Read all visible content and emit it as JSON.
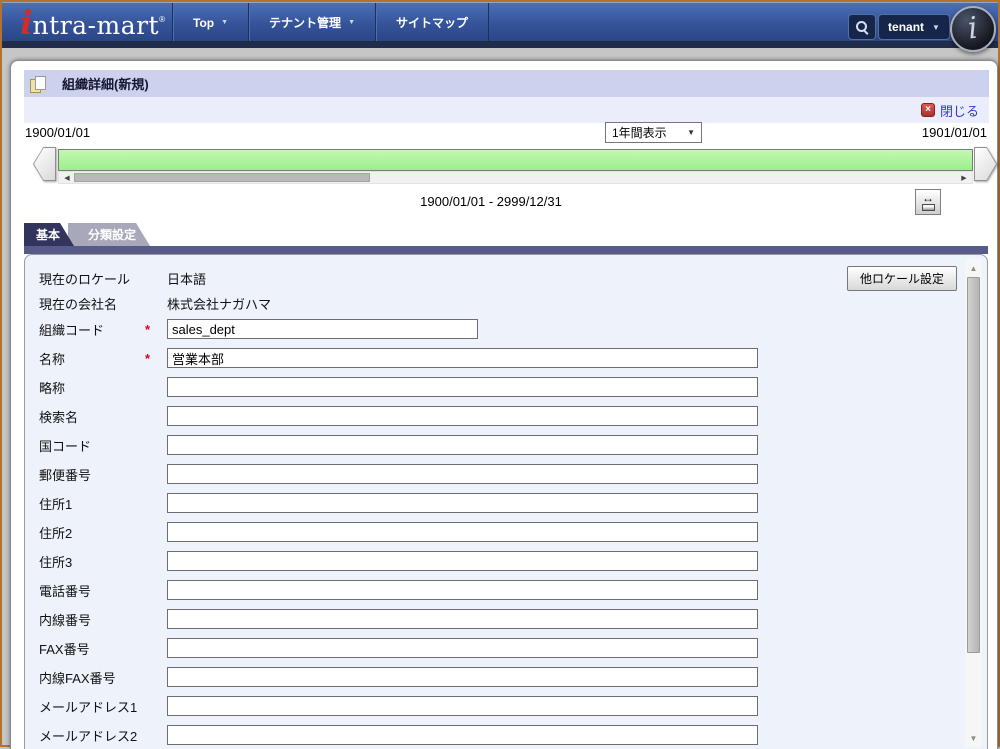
{
  "nav": {
    "logo": {
      "initial": "i",
      "rest": "ntra-mart",
      "registered": "®"
    },
    "menus": [
      {
        "label": "Top",
        "has_arrow": true
      },
      {
        "label": "テナント管理",
        "has_arrow": true
      },
      {
        "label": "サイトマップ",
        "has_arrow": false
      }
    ],
    "tenant_dropdown": "tenant",
    "corner_logo_glyph": "i"
  },
  "titlebar": {
    "title": "組織詳細(新規)",
    "close_label": "閉じる",
    "close_glyph": "×"
  },
  "timeline": {
    "start_date": "1900/01/01",
    "end_date": "1901/01/01",
    "range_select_value": "1年間表示",
    "range_text": "1900/01/01 - 2999/12/31",
    "fit_icon_glyph": "↔"
  },
  "tabs": [
    {
      "label": "基本",
      "active": true
    },
    {
      "label": "分類設定",
      "active": false
    }
  ],
  "form": {
    "other_locale_button": "他ロケール設定",
    "required_mark": "*",
    "rows": [
      {
        "key": "current-locale",
        "label": "現在のロケール",
        "type": "text",
        "value": "日本語",
        "required": false
      },
      {
        "key": "current-company",
        "label": "現在の会社名",
        "type": "text",
        "value": "株式会社ナガハマ",
        "required": false
      },
      {
        "key": "org-code",
        "label": "組織コード",
        "type": "input",
        "value": "sales_dept",
        "required": true,
        "width": "short"
      },
      {
        "key": "name",
        "label": "名称",
        "type": "input",
        "value": "営業本部",
        "required": true,
        "width": "long"
      },
      {
        "key": "short-name",
        "label": "略称",
        "type": "input",
        "value": "",
        "required": false,
        "width": "long"
      },
      {
        "key": "search-name",
        "label": "検索名",
        "type": "input",
        "value": "",
        "required": false,
        "width": "long"
      },
      {
        "key": "country-code",
        "label": "国コード",
        "type": "input",
        "value": "",
        "required": false,
        "width": "long"
      },
      {
        "key": "postal-code",
        "label": "郵便番号",
        "type": "input",
        "value": "",
        "required": false,
        "width": "long"
      },
      {
        "key": "address1",
        "label": "住所1",
        "type": "input",
        "value": "",
        "required": false,
        "width": "long"
      },
      {
        "key": "address2",
        "label": "住所2",
        "type": "input",
        "value": "",
        "required": false,
        "width": "long"
      },
      {
        "key": "address3",
        "label": "住所3",
        "type": "input",
        "value": "",
        "required": false,
        "width": "long"
      },
      {
        "key": "phone",
        "label": "電話番号",
        "type": "input",
        "value": "",
        "required": false,
        "width": "long"
      },
      {
        "key": "extension",
        "label": "内線番号",
        "type": "input",
        "value": "",
        "required": false,
        "width": "long"
      },
      {
        "key": "fax",
        "label": "FAX番号",
        "type": "input",
        "value": "",
        "required": false,
        "width": "long"
      },
      {
        "key": "extension-fax",
        "label": "内線FAX番号",
        "type": "input",
        "value": "",
        "required": false,
        "width": "long"
      },
      {
        "key": "email1",
        "label": "メールアドレス1",
        "type": "input",
        "value": "",
        "required": false,
        "width": "long"
      },
      {
        "key": "email2",
        "label": "メールアドレス2",
        "type": "input",
        "value": "",
        "required": false,
        "width": "long"
      }
    ]
  },
  "colors": {
    "frame_border": "#b5722f",
    "nav_blue_top": "#4a71b5",
    "nav_blue_bottom": "#2b4787",
    "nav_strip": "#222b49",
    "titlebar_bg": "#ccd2ed",
    "subbar_bg": "#ebeefa",
    "link_blue": "#2f3cc0",
    "close_red": "#b03030",
    "timeline_green": "#9cee8b",
    "tab_active": "#32345d",
    "tab_inactive": "#a7a8ba",
    "tab_bar": "#585a88",
    "panel_bg": "#edf2fb",
    "required_red": "#e00020"
  }
}
